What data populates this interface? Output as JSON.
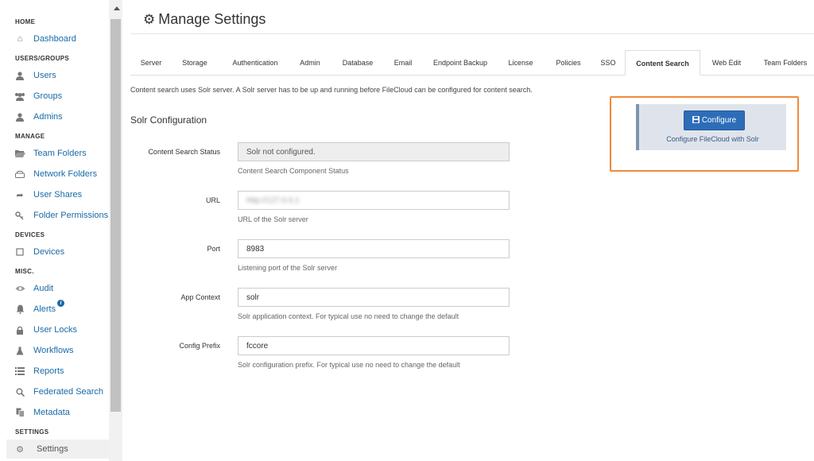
{
  "sidebar": {
    "sections": {
      "home": "HOME",
      "users_groups": "USERS/GROUPS",
      "manage": "MANAGE",
      "devices": "DEVICES",
      "misc": "MISC.",
      "settings": "SETTINGS"
    },
    "items": {
      "dashboard": {
        "label": "Dashboard",
        "icon": "home-icon"
      },
      "users": {
        "label": "Users",
        "icon": "user-icon"
      },
      "groups": {
        "label": "Groups",
        "icon": "users-icon"
      },
      "admins": {
        "label": "Admins",
        "icon": "admin-icon"
      },
      "team_folders": {
        "label": "Team Folders",
        "icon": "folder-open-icon"
      },
      "network_folders": {
        "label": "Network Folders",
        "icon": "drive-icon"
      },
      "user_shares": {
        "label": "User Shares",
        "icon": "share-icon"
      },
      "folder_permissions": {
        "label": "Folder Permissions",
        "icon": "key-icon"
      },
      "devices": {
        "label": "Devices",
        "icon": "device-icon"
      },
      "audit": {
        "label": "Audit",
        "icon": "eye-icon"
      },
      "alerts": {
        "label": "Alerts",
        "icon": "bell-icon",
        "badge": "i"
      },
      "user_locks": {
        "label": "User Locks",
        "icon": "lock-icon"
      },
      "workflows": {
        "label": "Workflows",
        "icon": "flask-icon"
      },
      "reports": {
        "label": "Reports",
        "icon": "list-icon"
      },
      "federated_search": {
        "label": "Federated Search",
        "icon": "search-icon"
      },
      "metadata": {
        "label": "Metadata",
        "icon": "copy-icon"
      },
      "settings": {
        "label": "Settings",
        "icon": "gear-icon"
      }
    }
  },
  "header": {
    "title": "Manage Settings",
    "icon": "gear-icon"
  },
  "tabs": [
    "Server",
    "Storage",
    "Authentication",
    "Admin",
    "Database",
    "Email",
    "Endpoint Backup",
    "License",
    "Policies",
    "SSO",
    "Content Search",
    "Web Edit",
    "Team Folders"
  ],
  "active_tab": "Content Search",
  "content": {
    "intro": "Content search uses Solr server. A Solr server has to be up and running before FileCloud can be configured for content search.",
    "section_title": "Solr Configuration",
    "fields": {
      "status": {
        "label": "Content Search Status",
        "value": "Solr not configured.",
        "help": "Content Search Component Status"
      },
      "url": {
        "label": "URL",
        "value": "http://127.0.0.1",
        "help": "URL of the Solr server"
      },
      "port": {
        "label": "Port",
        "value": "8983",
        "help": "Listening port of the Solr server"
      },
      "app_context": {
        "label": "App Context",
        "value": "solr",
        "help": "Solr application context. For typical use no need to change the default"
      },
      "config_prefix": {
        "label": "Config Prefix",
        "value": "fccore",
        "help": "Solr configuration prefix. For typical use no need to change the default"
      }
    }
  },
  "configure_panel": {
    "button_label": "Configure",
    "button_icon": "save-icon",
    "caption": "Configure FileCloud with Solr",
    "highlight_color": "#f08a3c"
  }
}
